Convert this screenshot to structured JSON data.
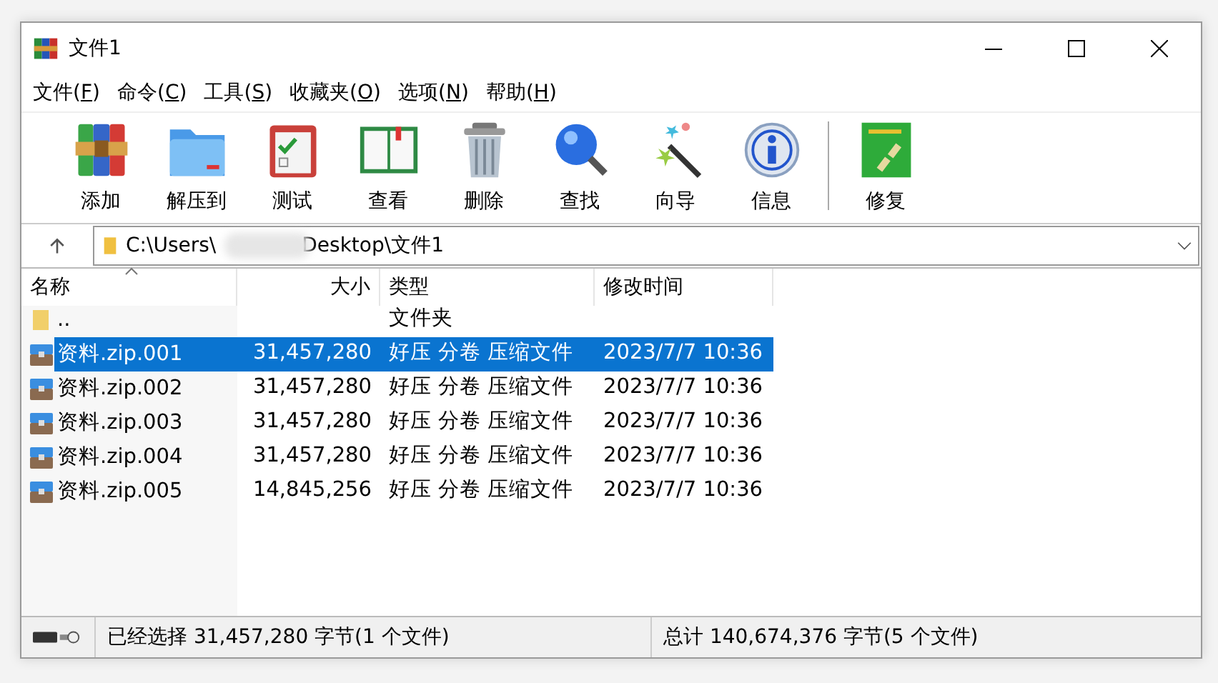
{
  "window": {
    "title": "文件1"
  },
  "menu": [
    {
      "before": "文件(",
      "hotkey": "F",
      "after": ")"
    },
    {
      "before": "命令(",
      "hotkey": "C",
      "after": ")"
    },
    {
      "before": "工具(",
      "hotkey": "S",
      "after": ")"
    },
    {
      "before": "收藏夹(",
      "hotkey": "O",
      "after": ")"
    },
    {
      "before": "选项(",
      "hotkey": "N",
      "after": ")"
    },
    {
      "before": "帮助(",
      "hotkey": "H",
      "after": ")"
    }
  ],
  "toolbar": [
    {
      "label": "添加",
      "kind": "archive"
    },
    {
      "label": "解压到",
      "kind": "folder"
    },
    {
      "label": "测试",
      "kind": "clipboard"
    },
    {
      "label": "查看",
      "kind": "book"
    },
    {
      "label": "删除",
      "kind": "trash"
    },
    {
      "label": "查找",
      "kind": "magnifier"
    },
    {
      "label": "向导",
      "kind": "wand"
    },
    {
      "label": "信息",
      "kind": "info"
    },
    {
      "label": "修复",
      "kind": "repair",
      "separator_before": true
    }
  ],
  "address": {
    "start": "C:\\Users\\",
    "end": "Desktop\\文件1"
  },
  "table": {
    "columns": [
      {
        "label": "名称",
        "sorted": true
      },
      {
        "label": "大小",
        "sorted": false
      },
      {
        "label": "类型",
        "sorted": false
      },
      {
        "label": "修改时间",
        "sorted": false
      }
    ],
    "rows": [
      {
        "kind": "folder",
        "name": "..",
        "size": "",
        "type": "文件夹",
        "modified": "",
        "selected": false
      },
      {
        "kind": "archive",
        "name": "资料.zip.001",
        "size": "31,457,280",
        "type": "好压 分卷 压缩文件",
        "modified": "2023/7/7 10:36",
        "selected": true
      },
      {
        "kind": "archive",
        "name": "资料.zip.002",
        "size": "31,457,280",
        "type": "好压 分卷 压缩文件",
        "modified": "2023/7/7 10:36",
        "selected": false
      },
      {
        "kind": "archive",
        "name": "资料.zip.003",
        "size": "31,457,280",
        "type": "好压 分卷 压缩文件",
        "modified": "2023/7/7 10:36",
        "selected": false
      },
      {
        "kind": "archive",
        "name": "资料.zip.004",
        "size": "31,457,280",
        "type": "好压 分卷 压缩文件",
        "modified": "2023/7/7 10:36",
        "selected": false
      },
      {
        "kind": "archive",
        "name": "资料.zip.005",
        "size": "14,845,256",
        "type": "好压 分卷 压缩文件",
        "modified": "2023/7/7 10:36",
        "selected": false
      }
    ]
  },
  "status_bar": {
    "selection": "已经选择 31,457,280 字节(1 个文件)",
    "total": "总计 140,674,376 字节(5 个文件)"
  }
}
